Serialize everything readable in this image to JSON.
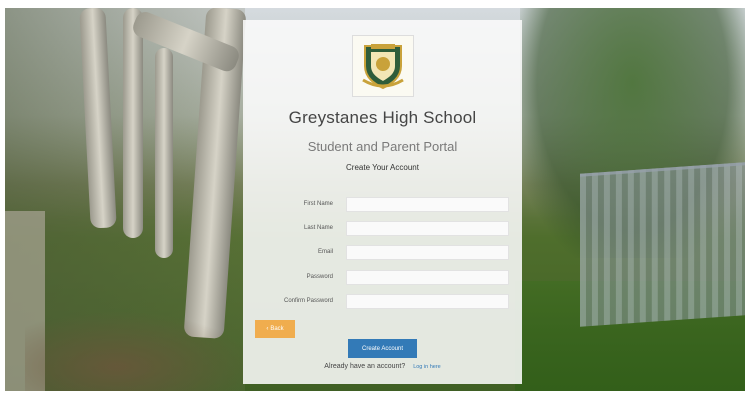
{
  "school": {
    "name": "Greystanes High School",
    "portal": "Student and Parent Portal"
  },
  "form": {
    "heading": "Create Your Account",
    "fields": [
      {
        "label": "First Name",
        "value": ""
      },
      {
        "label": "Last Name",
        "value": ""
      },
      {
        "label": "Email",
        "value": ""
      },
      {
        "label": "Password",
        "value": ""
      },
      {
        "label": "Confirm Password",
        "value": ""
      }
    ],
    "back_label": "Back",
    "back_icon": "chevron-left-icon",
    "submit_label": "Create Account"
  },
  "footer": {
    "prompt": "Already have an account?",
    "login_link": "Log in here"
  },
  "colors": {
    "back_button": "#f0ad4e",
    "submit_button": "#337ab7",
    "link": "#337ab7"
  }
}
